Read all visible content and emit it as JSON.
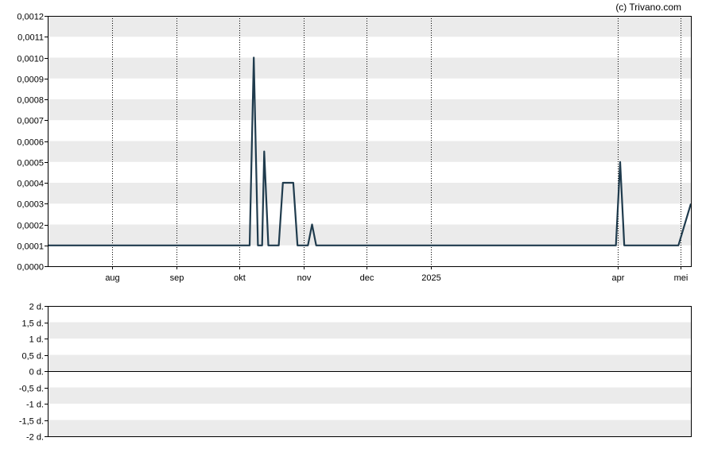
{
  "credit": "(c) Trivano.com",
  "colors": {
    "line": "#1f3b4d",
    "band": "#ebebeb",
    "frame": "#000000",
    "grid": "#000000"
  },
  "chart_data": [
    {
      "type": "line",
      "title": "",
      "xlabel": "",
      "ylabel": "",
      "ylim": [
        0,
        0.0012
      ],
      "yticks": [
        {
          "value": 0.0012,
          "label": "0,0012"
        },
        {
          "value": 0.0011,
          "label": "0,0011"
        },
        {
          "value": 0.001,
          "label": "0,0010"
        },
        {
          "value": 0.0009,
          "label": "0,0009"
        },
        {
          "value": 0.0008,
          "label": "0,0008"
        },
        {
          "value": 0.0007,
          "label": "0,0007"
        },
        {
          "value": 0.0006,
          "label": "0,0006"
        },
        {
          "value": 0.0005,
          "label": "0,0005"
        },
        {
          "value": 0.0004,
          "label": "0,0004"
        },
        {
          "value": 0.0003,
          "label": "0,0003"
        },
        {
          "value": 0.0002,
          "label": "0,0002"
        },
        {
          "value": 0.0001,
          "label": "0,0001"
        },
        {
          "value": 0.0,
          "label": "0,0000"
        }
      ],
      "xlim": [
        "2024-07-01",
        "2025-05-06"
      ],
      "xticks": [
        {
          "date": "2024-08-01",
          "label": "aug"
        },
        {
          "date": "2024-09-01",
          "label": "sep"
        },
        {
          "date": "2024-10-01",
          "label": "okt"
        },
        {
          "date": "2024-11-01",
          "label": "nov"
        },
        {
          "date": "2024-12-01",
          "label": "dec"
        },
        {
          "date": "2025-01-01",
          "label": "2025"
        },
        {
          "date": "2025-04-01",
          "label": "apr"
        },
        {
          "date": "2025-05-01",
          "label": "mei"
        }
      ],
      "grid": true,
      "series": [
        {
          "points": [
            {
              "x": "2024-07-01",
              "y": 0.0001
            },
            {
              "x": "2024-10-06",
              "y": 0.0001
            },
            {
              "x": "2024-10-08",
              "y": 0.001
            },
            {
              "x": "2024-10-10",
              "y": 0.0001
            },
            {
              "x": "2024-10-12",
              "y": 0.0001
            },
            {
              "x": "2024-10-13",
              "y": 0.00055
            },
            {
              "x": "2024-10-15",
              "y": 0.0001
            },
            {
              "x": "2024-10-20",
              "y": 0.0001
            },
            {
              "x": "2024-10-22",
              "y": 0.0004
            },
            {
              "x": "2024-10-27",
              "y": 0.0004
            },
            {
              "x": "2024-10-29",
              "y": 0.0001
            },
            {
              "x": "2024-11-03",
              "y": 0.0001
            },
            {
              "x": "2024-11-05",
              "y": 0.0002
            },
            {
              "x": "2024-11-07",
              "y": 0.0001
            },
            {
              "x": "2024-11-20",
              "y": 0.0001
            },
            {
              "x": "2025-01-02",
              "y": 0.0001
            },
            {
              "x": "2025-03-31",
              "y": 0.0001
            },
            {
              "x": "2025-04-02",
              "y": 0.0005
            },
            {
              "x": "2025-04-04",
              "y": 0.0001
            },
            {
              "x": "2025-04-30",
              "y": 0.0001
            },
            {
              "x": "2025-05-06",
              "y": 0.0003
            }
          ]
        }
      ]
    },
    {
      "type": "line",
      "title": "",
      "xlabel": "",
      "ylabel": "",
      "ylim": [
        -2,
        2
      ],
      "yticks": [
        {
          "value": 2,
          "label": "2 d."
        },
        {
          "value": 1.5,
          "label": "1,5 d."
        },
        {
          "value": 1,
          "label": "1 d."
        },
        {
          "value": 0.5,
          "label": "0,5 d."
        },
        {
          "value": 0,
          "label": "0 d."
        },
        {
          "value": -0.5,
          "label": "-0,5 d."
        },
        {
          "value": -1,
          "label": "-1 d."
        },
        {
          "value": -1.5,
          "label": "-1,5 d."
        },
        {
          "value": -2,
          "label": "-2 d."
        }
      ],
      "baseline": 0,
      "series": []
    }
  ]
}
